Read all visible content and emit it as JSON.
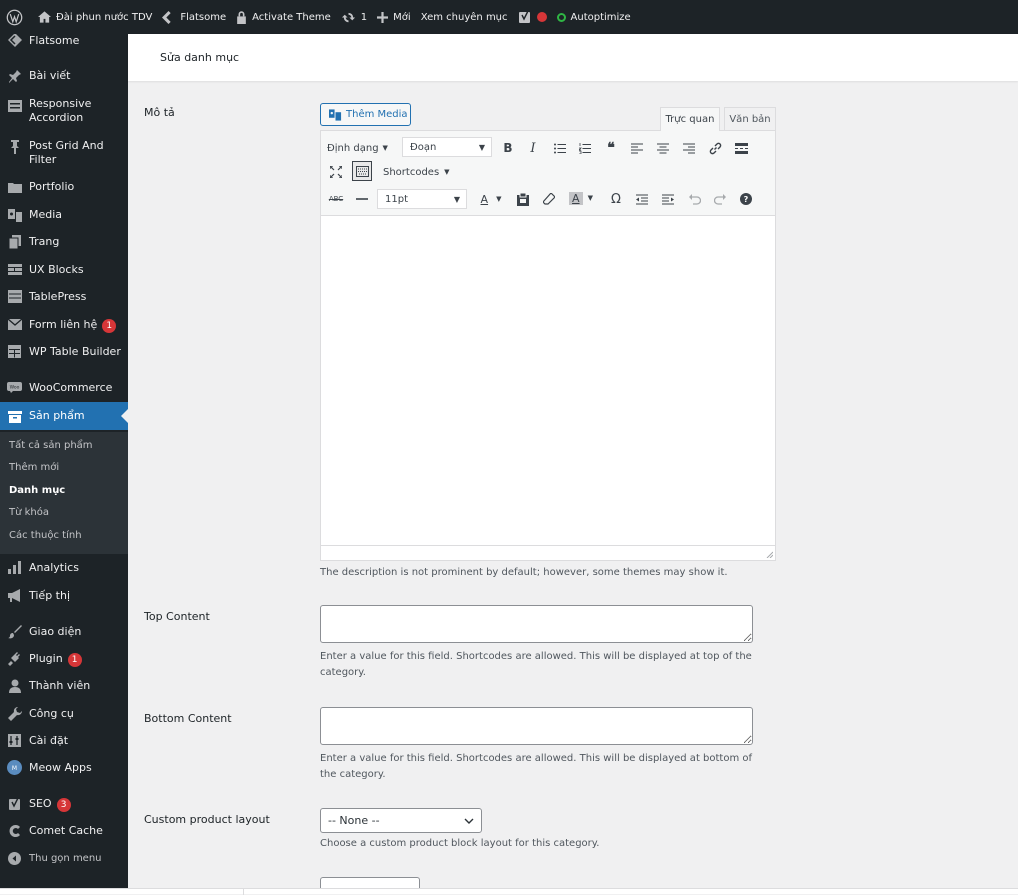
{
  "adminbar": {
    "site_name": "Đài phun nước TDV",
    "theme": "Flatsome",
    "activate": "Activate Theme",
    "updates": "1",
    "new": "Mới",
    "view_category": "Xem chuyên mục",
    "autoptimize": "Autoptimize"
  },
  "sidebar": {
    "items": [
      {
        "label": "Flatsome"
      },
      {
        "label": "Bài viết"
      },
      {
        "label": "Responsive"
      },
      {
        "label": "Accordion"
      },
      {
        "label": "Post Grid And"
      },
      {
        "label": "Filter"
      },
      {
        "label": "Portfolio"
      },
      {
        "label": "Media"
      },
      {
        "label": "Trang"
      },
      {
        "label": "UX Blocks"
      },
      {
        "label": "TablePress"
      },
      {
        "label": "Form liên hệ",
        "badge": "1"
      },
      {
        "label": "WP Table Builder"
      },
      {
        "label": "WooCommerce"
      },
      {
        "label": "Sản phẩm"
      },
      {
        "label": "Analytics"
      },
      {
        "label": "Tiếp thị"
      },
      {
        "label": "Giao diện"
      },
      {
        "label": "Plugin",
        "badge": "1"
      },
      {
        "label": "Thành viên"
      },
      {
        "label": "Công cụ"
      },
      {
        "label": "Cài đặt"
      },
      {
        "label": "Meow Apps"
      },
      {
        "label": "SEO",
        "badge": "3"
      },
      {
        "label": "Comet Cache"
      },
      {
        "label": "Thu gọn menu"
      }
    ],
    "submenu": [
      "Tất cả sản phẩm",
      "Thêm mới",
      "Danh mục",
      "Từ khóa",
      "Các thuộc tính"
    ]
  },
  "header": {
    "title": "Sửa danh mục"
  },
  "form": {
    "description_label": "Mô tả",
    "add_media": "Thêm Media",
    "tab_visual": "Trực quan",
    "tab_text": "Văn bản",
    "toolbar": {
      "format_menu": "Định dạng",
      "paragraph": "Đoạn",
      "shortcodes": "Shortcodes",
      "font_size": "11pt"
    },
    "description_help": "The description is not prominent by default; however, some themes may show it.",
    "top_content_label": "Top Content",
    "top_content_help": "Enter a value for this field. Shortcodes are allowed. This will be displayed at top of the category.",
    "bottom_content_label": "Bottom Content",
    "bottom_content_help": "Enter a value for this field. Shortcodes are allowed. This will be displayed at bottom of the category.",
    "layout_label": "Custom product layout",
    "layout_value": "-- None --",
    "layout_help": "Choose a custom product block layout for this category."
  },
  "colors": {
    "admin_bg": "#1d2327",
    "accent": "#2271b1",
    "badge": "#d63638"
  }
}
